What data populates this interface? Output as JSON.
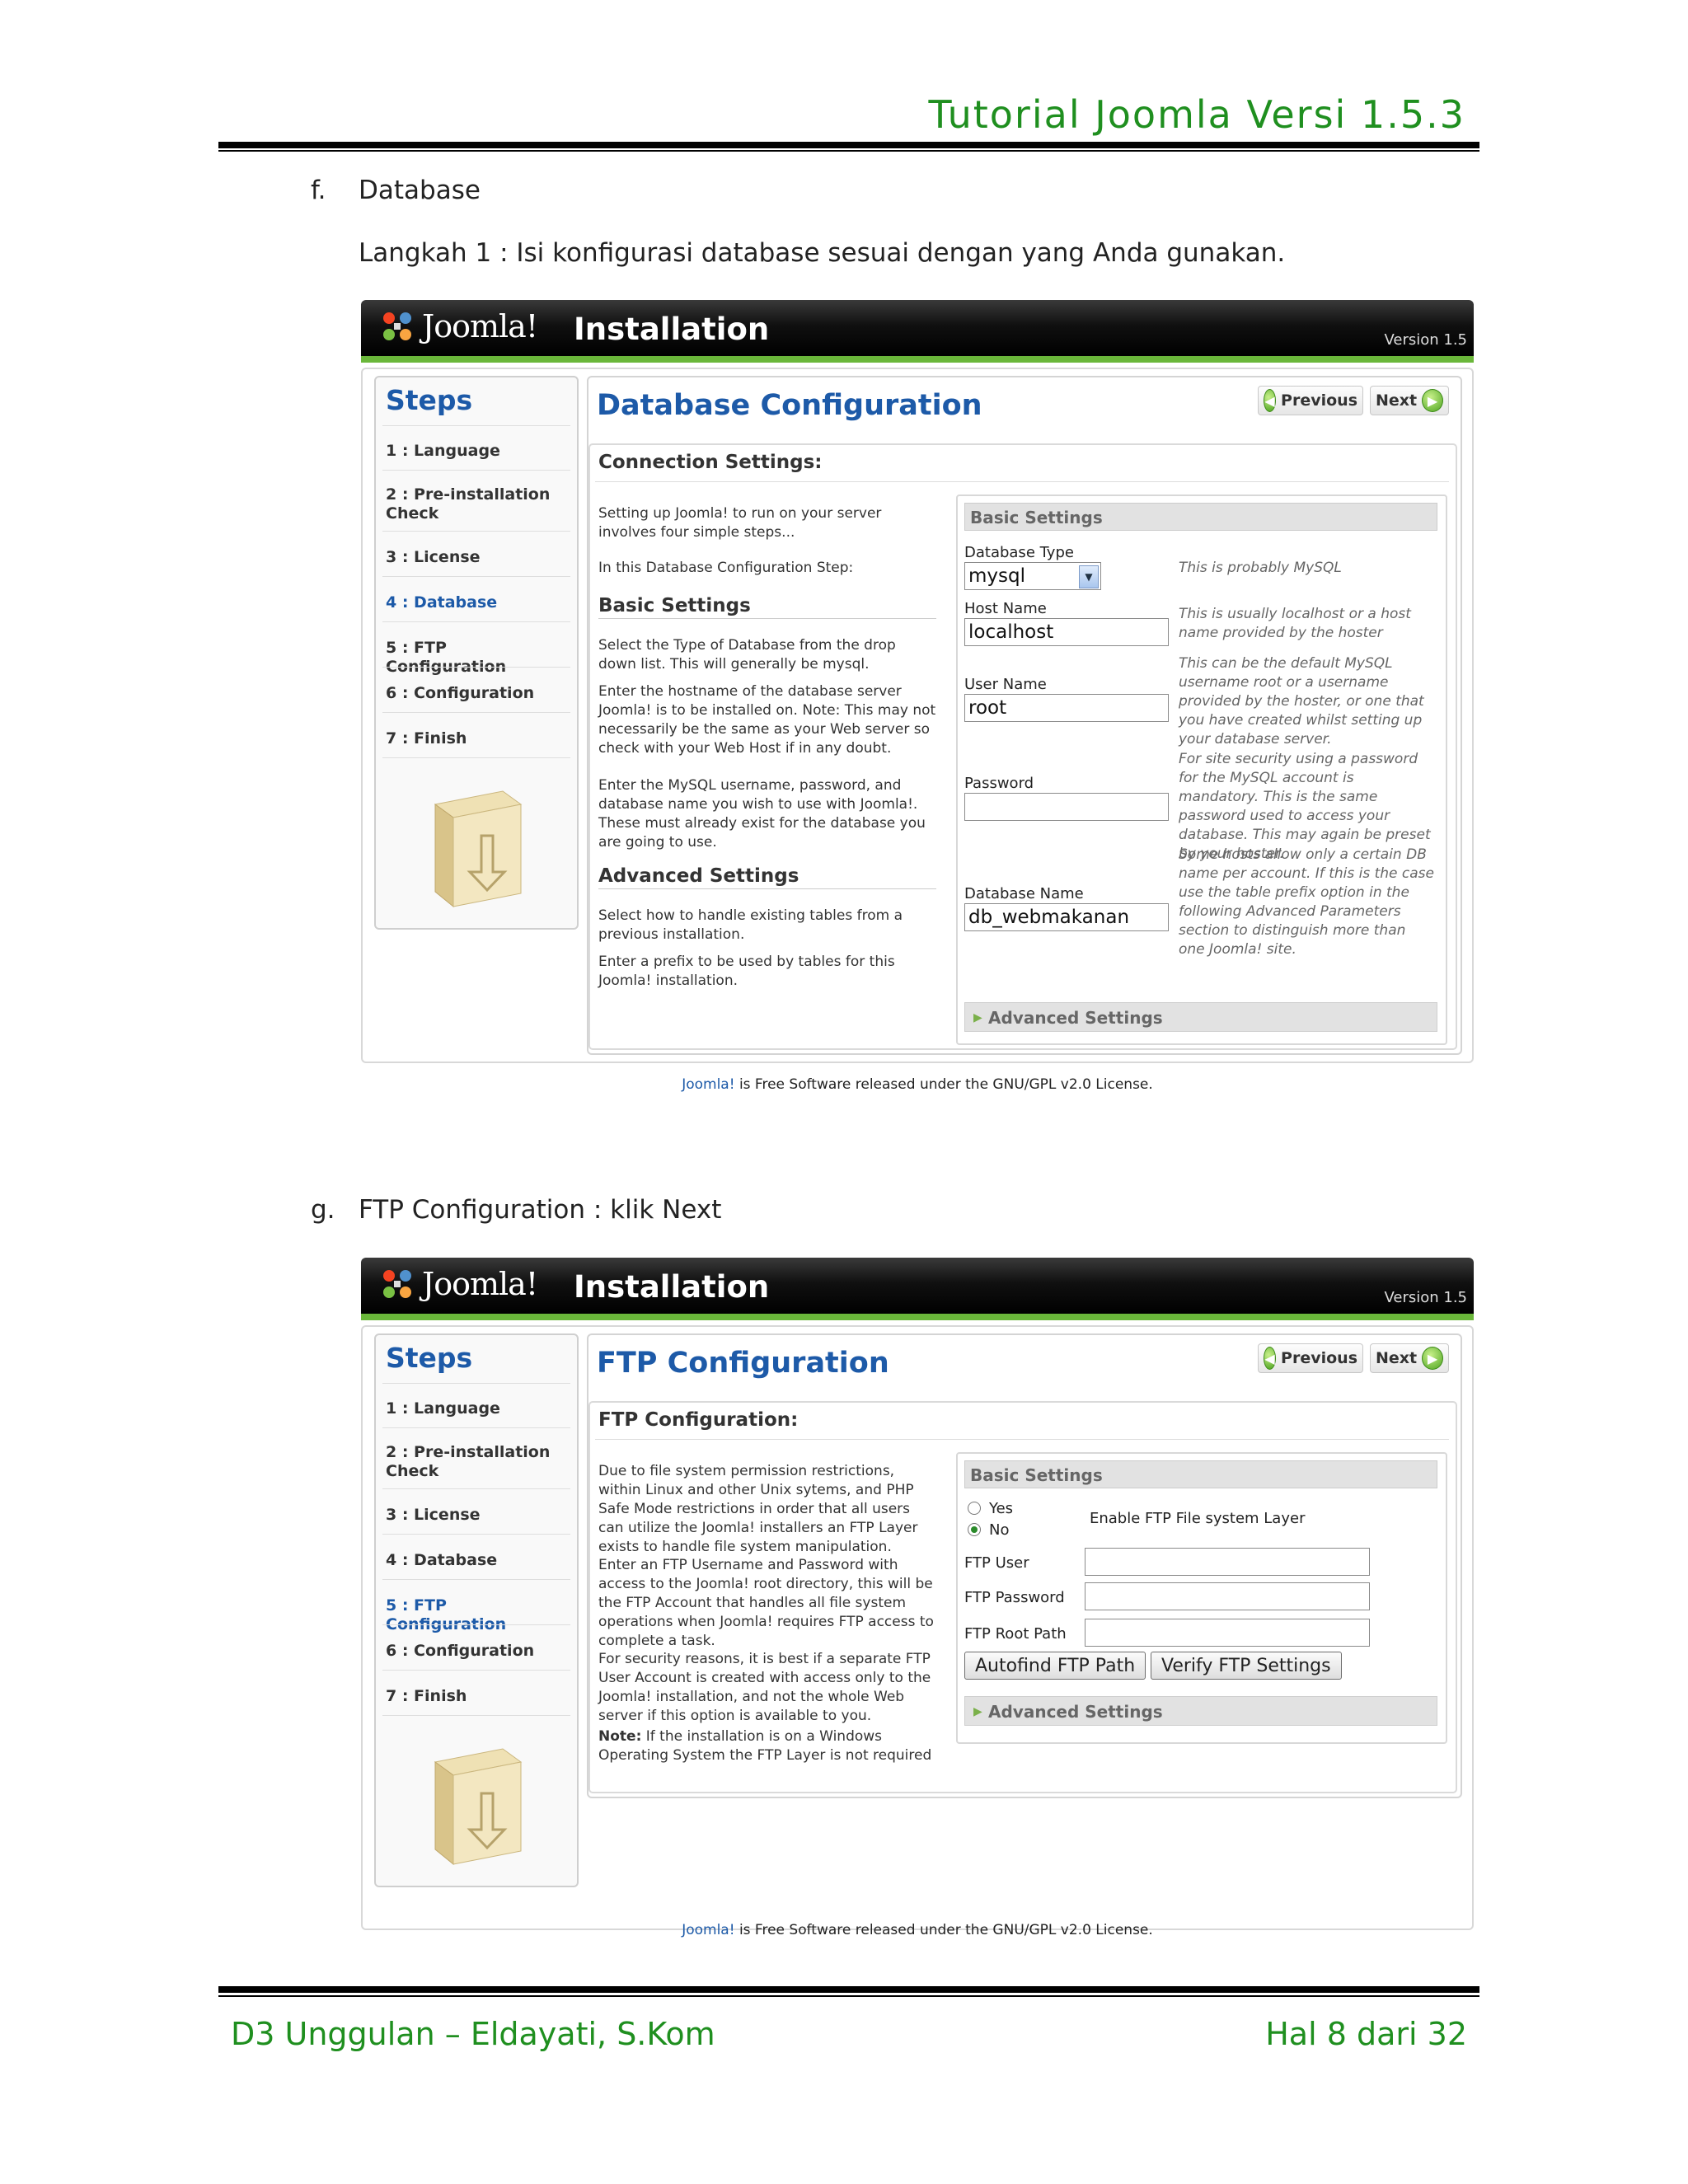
{
  "doc": {
    "title": "Tutorial Joomla Versi 1.5.3",
    "footer_left": "D3 Unggulan – Eldayati, S.Kom",
    "footer_right": "Hal 8 dari 32"
  },
  "section_f": {
    "letter": "f.",
    "heading": "Database",
    "step_text": "Langkah 1 : Isi konfigurasi database sesuai dengan yang Anda gunakan."
  },
  "section_g": {
    "letter": "g.",
    "heading": "FTP Configuration : klik Next"
  },
  "joomla": {
    "logo_text": "Joomla!",
    "installation": "Installation",
    "version": "Version 1.5",
    "steps_title": "Steps",
    "steps": [
      "1 : Language",
      "2 : Pre-installation Check",
      "3 : License",
      "4 : Database",
      "5 : FTP Configuration",
      "6 : Configuration",
      "7 : Finish"
    ],
    "prev_label": "Previous",
    "next_label": "Next",
    "advanced_settings": "Advanced Settings",
    "basic_settings_panel": "Basic Settings",
    "footer_link": "Joomla!",
    "footer_text": " is Free Software released under the GNU/GPL v2.0 License.",
    "accent_color": "#1d5aa8",
    "green_color": "#6ab73a"
  },
  "db_screen": {
    "title": "Database Configuration",
    "connection_title": "Connection Settings:",
    "intro": "Setting up Joomla! to run on your server involves four simple steps...",
    "intro2": "In this Database Configuration Step:",
    "basic_head": "Basic Settings",
    "basic_p1": "Select the Type of Database from the drop down list. This will generally be mysql.",
    "basic_p2": "Enter the hostname of the database server Joomla! is to be installed on. Note: This may not necessarily be the same as your Web server so check with your Web Host if in any doubt.",
    "basic_p3": "Enter the MySQL username, password, and database name you wish to use with Joomla!. These must already exist for the database you are going to use.",
    "advanced_head": "Advanced Settings",
    "adv_p1": "Select how to handle existing tables from a previous installation.",
    "adv_p2": "Enter a prefix to be used by tables for this Joomla! installation.",
    "fields": {
      "db_type_label": "Database Type",
      "db_type_value": "mysql",
      "db_type_help": "This is probably MySQL",
      "host_label": "Host Name",
      "host_value": "localhost",
      "host_help": "This is usually localhost or a host name provided by the hoster",
      "user_label": "User Name",
      "user_value": "root",
      "user_help": "This can be the default MySQL username root or a username provided by the hoster, or one that you have created whilst setting up your database server.",
      "password_label": "Password",
      "password_value": "",
      "password_help": "For site security using a password for the MySQL account is mandatory. This is the same password used to access your database. This may again be preset by your hoster.",
      "dbname_label": "Database Name",
      "dbname_value": "db_webmakanan",
      "dbname_help": "Some hosts allow only a certain DB name per account. If this is the case use the table prefix option in the following Advanced Parameters section to distinguish more than one Joomla! site."
    }
  },
  "ftp_screen": {
    "title": "FTP Configuration",
    "connection_title": "FTP Configuration:",
    "p1": "Due to file system permission restrictions, within Linux and other Unix sytems, and PHP Safe Mode restrictions in order that all users can utilize the Joomla! installers an FTP Layer exists to handle file system manipulation.",
    "p2": "Enter an FTP Username and Password with access to the Joomla! root directory, this will be the FTP Account that handles all file system operations when Joomla! requires FTP access to complete a task.",
    "p3": "For security reasons, it is best if a separate FTP User Account is created with access only to the Joomla! installation, and not the whole Web server if this option is available to you.",
    "note_label": "Note:",
    "note_text": " If the installation is on a Windows Operating System the FTP Layer is not required",
    "yes_label": "Yes",
    "no_label": "No",
    "enable_label": "Enable FTP File system Layer",
    "ftp_user_label": "FTP User",
    "ftp_password_label": "FTP Password",
    "ftp_root_label": "FTP Root Path",
    "autofind_button": "Autofind FTP Path",
    "verify_button": "Verify FTP Settings"
  }
}
